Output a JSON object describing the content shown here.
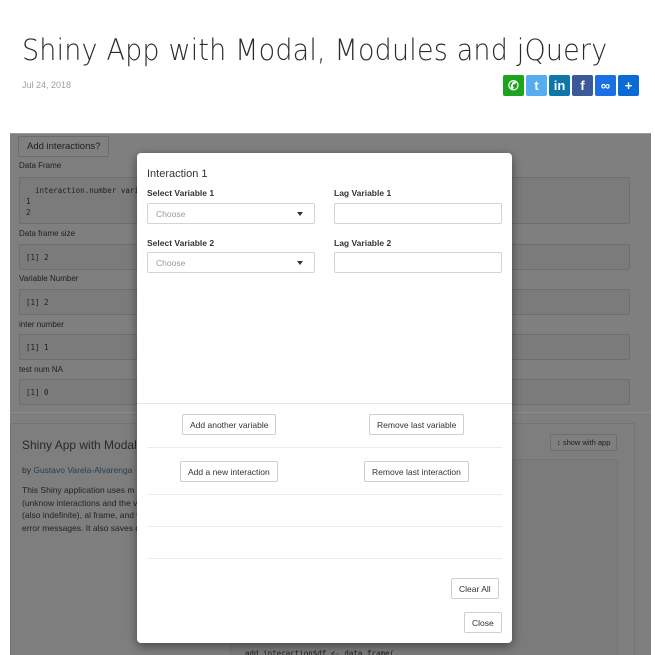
{
  "post": {
    "title": "Shiny App with Modal, Modules and jQuery",
    "date": "Jul 24, 2018",
    "share_buttons": [
      {
        "name": "whatsapp",
        "icon": "whatsapp-icon",
        "glyph": "✆",
        "color": "#1ea31e"
      },
      {
        "name": "twitter",
        "icon": "twitter-icon",
        "glyph": "t",
        "color": "#55acee"
      },
      {
        "name": "linkedin",
        "icon": "linkedin-icon",
        "glyph": "in",
        "color": "#0e76a8"
      },
      {
        "name": "facebook",
        "icon": "facebook-icon",
        "glyph": "f",
        "color": "#3b5998"
      },
      {
        "name": "copy-link",
        "icon": "link-icon",
        "glyph": "∞",
        "color": "#1a6ee6"
      },
      {
        "name": "more",
        "icon": "plus-icon",
        "glyph": "+",
        "color": "#0b6bd6"
      }
    ]
  },
  "app": {
    "add_interactions_button": "Add interactions?",
    "outputs": [
      {
        "label": "Data Frame",
        "value": "  interaction.number vari\n1\n2"
      },
      {
        "label": "Data frame size",
        "value": "[1] 2"
      },
      {
        "label": "Variable Number",
        "value": "[1] 2"
      },
      {
        "label": "inter number",
        "value": "[1] 1"
      },
      {
        "label": "test num NA",
        "value": "[1] 0"
      }
    ],
    "panel": {
      "title": "Shiny App with Modal, some jQuery.",
      "by_prefix": "by ",
      "author": "Gustavo Varela-Alvarenga",
      "description": "This Shiny application uses m remove an indefinite (unknow interactions and the variables interaction (also indefinite), al frame, and with some jQuery error messages. It also saves dataframe.",
      "show_with_app_button": "show with app",
      "code_line": "add.interaction$df <- data.frame("
    }
  },
  "modal": {
    "title": "Interaction 1",
    "fields": [
      {
        "label": "Select Variable 1",
        "placeholder": "Choose"
      },
      {
        "label": "Lag Variable 1",
        "value": ""
      },
      {
        "label": "Select Variable 2",
        "placeholder": "Choose"
      },
      {
        "label": "Lag Variable 2",
        "value": ""
      }
    ],
    "buttons": {
      "add_variable": "Add another variable",
      "remove_variable": "Remove last variable",
      "add_interaction": "Add a new interaction",
      "remove_interaction": "Remove last interaction",
      "clear_all": "Clear All",
      "close": "Close"
    }
  }
}
